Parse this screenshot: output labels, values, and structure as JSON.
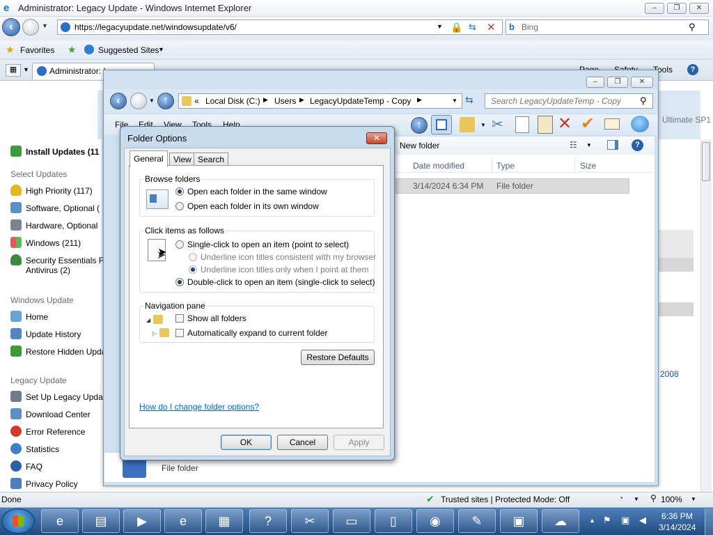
{
  "ie": {
    "title": "Administrator: Legacy Update - Windows Internet Explorer",
    "address": "https://legacyupdate.net/windowsupdate/v6/",
    "search_placeholder": "Bing",
    "favorites_label": "Favorites",
    "suggested_label": "Suggested Sites",
    "tab_label": "Administrator: L",
    "page_tab": "Page",
    "safety_tab": "Safety",
    "tools_tab": "Tools",
    "status": "Done",
    "zone": "Trusted sites | Protected Mode: Off",
    "zoom": "100%"
  },
  "page": {
    "install_updates": "Install Updates (11",
    "select_updates_head": "Select Updates",
    "items": [
      "High Priority (117)",
      "Software, Optional (",
      "Hardware, Optional",
      "Windows (211)",
      "Security Essentials F",
      "Antivirus (2)"
    ],
    "windows_update_head": "Windows Update",
    "wu_items": [
      "Home",
      "Update History",
      "Restore Hidden Upda"
    ],
    "legacy_update_head": "Legacy Update",
    "lu_items": [
      "Set Up Legacy Updat",
      "Download Center",
      "Error Reference",
      "Statistics",
      "FAQ",
      "Privacy Policy"
    ],
    "right_text": "Ultimate SP1",
    "right_year": "2008"
  },
  "explorer": {
    "path_prefix": "«",
    "path": [
      "Local Disk (C:)",
      "Users",
      "LegacyUpdateTemp - Copy"
    ],
    "search_placeholder": "Search LegacyUpdateTemp - Copy",
    "menus": [
      "File",
      "Edit",
      "View",
      "Tools",
      "Help"
    ],
    "new_folder": "New folder",
    "columns": [
      "Date modified",
      "Type",
      "Size"
    ],
    "row": {
      "date": "3/14/2024 6:34 PM",
      "type": "File folder"
    },
    "lower_type": "File folder"
  },
  "dialog": {
    "title": "Folder Options",
    "tabs": [
      "General",
      "View",
      "Search"
    ],
    "browse_label": "Browse folders",
    "browse_opts": [
      "Open each folder in the same window",
      "Open each folder in its own window"
    ],
    "click_label": "Click items as follows",
    "click_opts": [
      "Single-click to open an item (point to select)",
      "Underline icon titles consistent with my browser",
      "Underline icon titles only when I point at them",
      "Double-click to open an item (single-click to select)"
    ],
    "nav_label": "Navigation pane",
    "nav_opts": [
      "Show all folders",
      "Automatically expand to current folder"
    ],
    "restore_defaults": "Restore Defaults",
    "help_link": "How do I change folder options?",
    "ok": "OK",
    "cancel": "Cancel",
    "apply": "Apply"
  },
  "taskbar": {
    "time": "6:36 PM",
    "date": "3/14/2024"
  }
}
